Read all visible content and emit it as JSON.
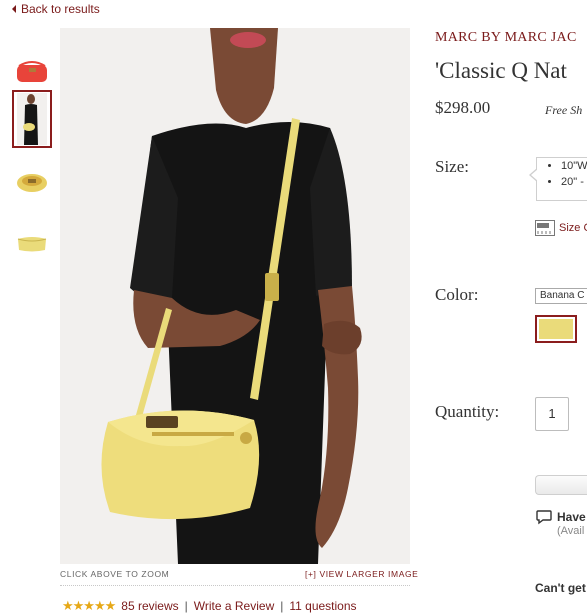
{
  "nav": {
    "back_label": "Back to results"
  },
  "gallery": {
    "thumbnails": [
      {
        "label": "red bag thumbnail",
        "color": "#e8443a"
      },
      {
        "label": "model wearing bag thumbnail",
        "color": "#eadb7a"
      },
      {
        "label": "bag top view thumbnail",
        "color": "#e8cf62"
      },
      {
        "label": "bag front view thumbnail",
        "color": "#eadb7a"
      }
    ],
    "selected_index": 1,
    "caption_left": "CLICK ABOVE TO ZOOM",
    "caption_right": "[+] VIEW LARGER IMAGE"
  },
  "reviews": {
    "stars": "★★★★★",
    "reviews_label": "85 reviews",
    "separator": "|",
    "write_label": "Write a Review",
    "questions_label": "11 questions"
  },
  "product": {
    "brand": "MARC BY MARC JAC",
    "title": "'Classic Q Nat",
    "price": "$298.00",
    "free_shipping": "Free Sh"
  },
  "options": {
    "size_label": "Size:",
    "sizes": [
      "10\"W",
      "20\" -"
    ],
    "size_chart_label": "Size C",
    "color_label": "Color:",
    "color_selected": "Banana C",
    "swatch_color": "#eadb7a",
    "quantity_label": "Quantity:",
    "quantity_value": "1"
  },
  "help": {
    "chat_title": "Have",
    "chat_sub": "(Avail",
    "cant_get": "Can't get"
  },
  "colors": {
    "accent": "#7a1a1a",
    "selected_border": "#8b1d1d",
    "star": "#e6a817"
  }
}
